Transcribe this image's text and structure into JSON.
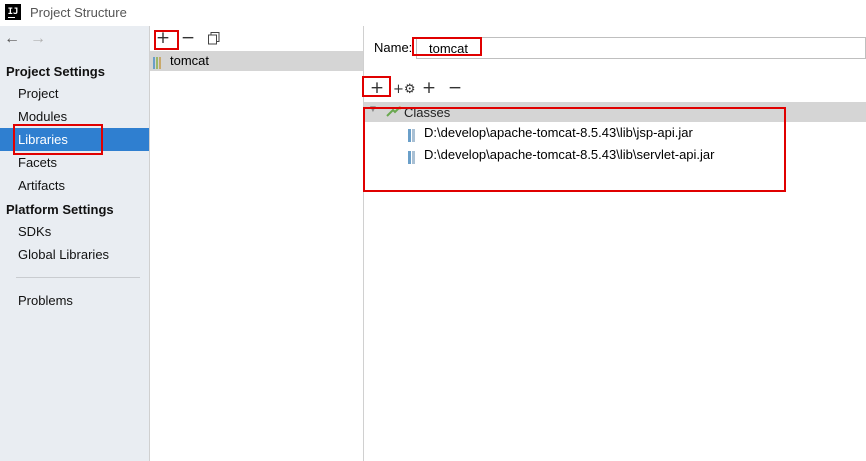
{
  "window": {
    "title": "Project Structure",
    "app_icon_text": "IJ"
  },
  "nav": {
    "back_glyph": "←",
    "forward_glyph": "→"
  },
  "sidebar": {
    "project_settings_heading": "Project Settings",
    "project_items": [
      "Project",
      "Modules",
      "Libraries",
      "Facets",
      "Artifacts"
    ],
    "platform_settings_heading": "Platform Settings",
    "platform_items": [
      "SDKs",
      "Global Libraries"
    ],
    "problems_label": "Problems",
    "selected_item": "Libraries"
  },
  "libraries": {
    "items": [
      "tomcat"
    ],
    "selected": "tomcat"
  },
  "detail": {
    "name_label": "Name:",
    "name_value": "tomcat",
    "classes_label": "Classes",
    "class_entries": [
      "D:\\develop\\apache-tomcat-8.5.43\\lib\\jsp-api.jar",
      "D:\\develop\\apache-tomcat-8.5.43\\lib\\servlet-api.jar"
    ]
  },
  "colors": {
    "selection_blue": "#2f7fd0",
    "sidebar_bg": "#e9edf2",
    "highlight_red": "#e00000",
    "row_gray": "#d5d5d5"
  },
  "icons": {
    "add": "+",
    "remove": "−",
    "copy": "copy-icon",
    "add_with_settings": "+⚙",
    "add_alt": "+",
    "remove_alt": "−"
  }
}
